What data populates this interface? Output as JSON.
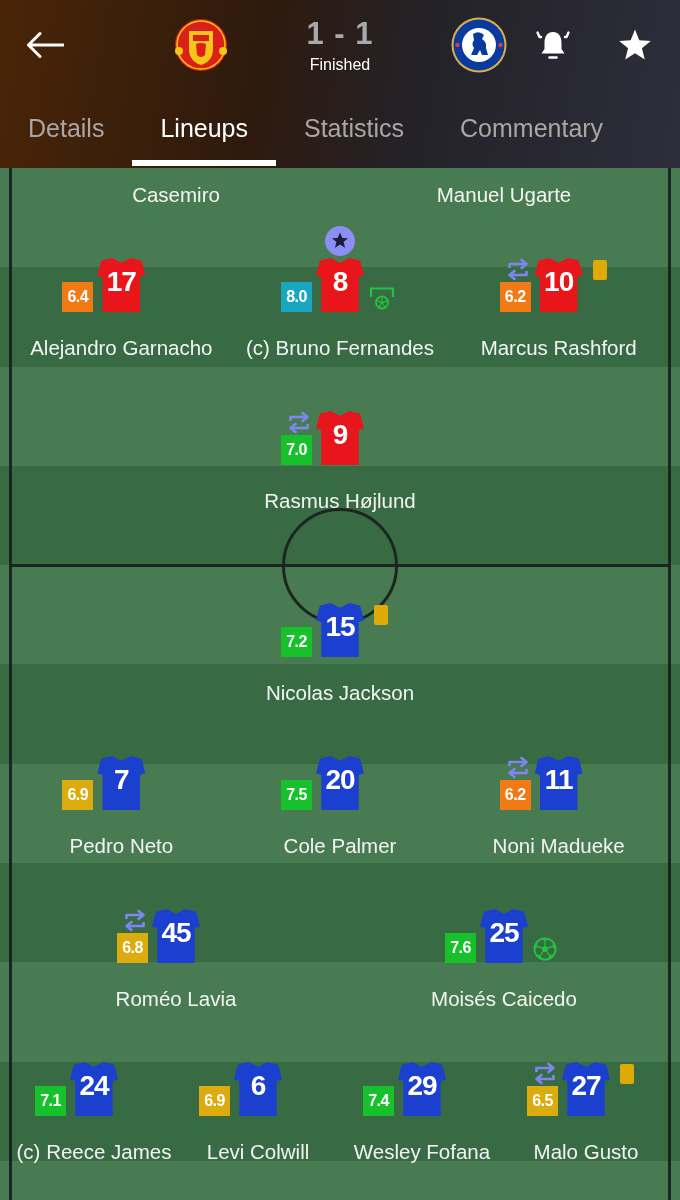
{
  "header": {
    "score": "1 - 1",
    "status": "Finished"
  },
  "tabs": [
    {
      "label": "Details",
      "selected": false
    },
    {
      "label": "Lineups",
      "selected": true
    },
    {
      "label": "Statistics",
      "selected": false
    },
    {
      "label": "Commentary",
      "selected": false
    }
  ],
  "teams": [
    {
      "color": "#e8161b",
      "partial_line": [
        {
          "name": "Casemiro"
        },
        {
          "name": "Manuel Ugarte"
        }
      ],
      "lines": [
        {
          "players": [
            {
              "name": "Alejandro Garnacho",
              "number": "17",
              "rating": {
                "value": "6.4",
                "color": "#f27a14"
              }
            },
            {
              "name": "(c) Bruno Fernandes",
              "number": "8",
              "rating": {
                "value": "8.0",
                "color": "#1aa6c0"
              },
              "events": [
                {
                  "kind": "top_rated"
                },
                {
                  "kind": "penalty_goal"
                }
              ]
            },
            {
              "name": "Marcus Rashford",
              "number": "10",
              "rating": {
                "value": "6.2",
                "color": "#f27a14"
              },
              "events": [
                {
                  "kind": "substitution"
                },
                {
                  "kind": "yellow_card"
                }
              ]
            }
          ]
        },
        {
          "players": [
            {
              "name": "Rasmus Højlund",
              "number": "9",
              "rating": {
                "value": "7.0",
                "color": "#16c12c"
              },
              "events": [
                {
                  "kind": "substitution"
                }
              ]
            }
          ]
        }
      ]
    },
    {
      "color": "#1b3fcf",
      "lines": [
        {
          "players": [
            {
              "name": "Nicolas Jackson",
              "number": "15",
              "rating": {
                "value": "7.2",
                "color": "#16c12c"
              },
              "events": [
                {
                  "kind": "yellow_card"
                }
              ]
            }
          ]
        },
        {
          "players": [
            {
              "name": "Pedro Neto",
              "number": "7",
              "rating": {
                "value": "6.9",
                "color": "#dcab0e"
              }
            },
            {
              "name": "Cole Palmer",
              "number": "20",
              "rating": {
                "value": "7.5",
                "color": "#16c12c"
              }
            },
            {
              "name": "Noni Madueke",
              "number": "11",
              "rating": {
                "value": "6.2",
                "color": "#f27a14"
              },
              "events": [
                {
                  "kind": "substitution"
                }
              ]
            }
          ]
        },
        {
          "players": [
            {
              "name": "Roméo Lavia",
              "number": "45",
              "rating": {
                "value": "6.8",
                "color": "#dcab0e"
              },
              "events": [
                {
                  "kind": "substitution"
                }
              ]
            },
            {
              "name": "Moisés Caicedo",
              "number": "25",
              "rating": {
                "value": "7.6",
                "color": "#16c12c"
              },
              "events": [
                {
                  "kind": "goal"
                }
              ]
            }
          ]
        },
        {
          "players": [
            {
              "name": "(c) Reece James",
              "number": "24",
              "rating": {
                "value": "7.1",
                "color": "#16c12c"
              }
            },
            {
              "name": "Levi Colwill",
              "number": "6",
              "rating": {
                "value": "6.9",
                "color": "#dcab0e"
              }
            },
            {
              "name": "Wesley Fofana",
              "number": "29",
              "rating": {
                "value": "7.4",
                "color": "#16c12c"
              }
            },
            {
              "name": "Malo Gusto",
              "number": "27",
              "rating": {
                "value": "6.5",
                "color": "#dcab0e"
              },
              "events": [
                {
                  "kind": "substitution"
                },
                {
                  "kind": "yellow_card"
                }
              ]
            }
          ]
        }
      ]
    }
  ]
}
